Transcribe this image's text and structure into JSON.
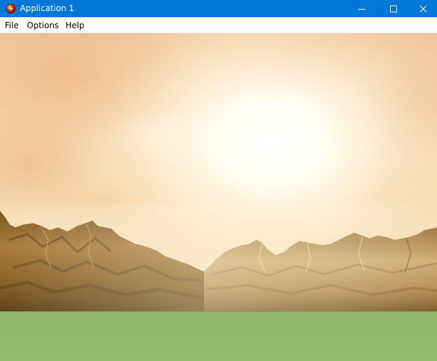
{
  "window": {
    "title": "Application 1",
    "icon": "app-orb-icon",
    "controls": [
      "minimize-icon",
      "maximize-icon",
      "close-icon"
    ]
  },
  "menu": {
    "items": [
      {
        "label": "File"
      },
      {
        "label": "Options"
      },
      {
        "label": "Help"
      }
    ]
  },
  "scene": {
    "description_type": "3d-rendered-landscape",
    "colors": {
      "titlebar": "#0078d7",
      "sky_top": "#f2c79c",
      "sky_glow": "#fffdf0",
      "mountain_dark": "#6b4a1e",
      "mountain_light": "#d9b67a",
      "ground": "#93b86e"
    }
  }
}
